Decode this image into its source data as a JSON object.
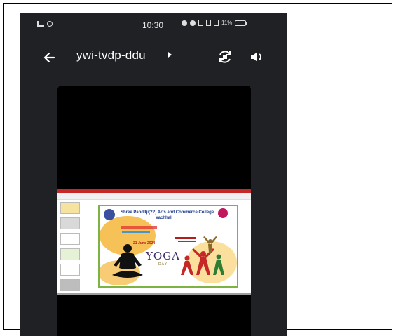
{
  "status_bar": {
    "time": "10:30",
    "battery_text": "11%"
  },
  "app_bar": {
    "title": "ywi-tvdp-ddu",
    "back_icon": "arrow-left-icon",
    "rotate_icon": "screen-rotate-icon",
    "volume_icon": "volume-icon"
  },
  "slide": {
    "header_line1": "Shree Panditji(??) Arts and Commerce College",
    "header_line2": "Vachhal",
    "date_text": "21 June 2024",
    "yoga_text": "YOGA",
    "day_text": "DAY"
  },
  "colors": {
    "app_background": "#202124",
    "video_background": "#000000",
    "slide_border": "#7cb342",
    "slide_topbar": "#c62828"
  }
}
